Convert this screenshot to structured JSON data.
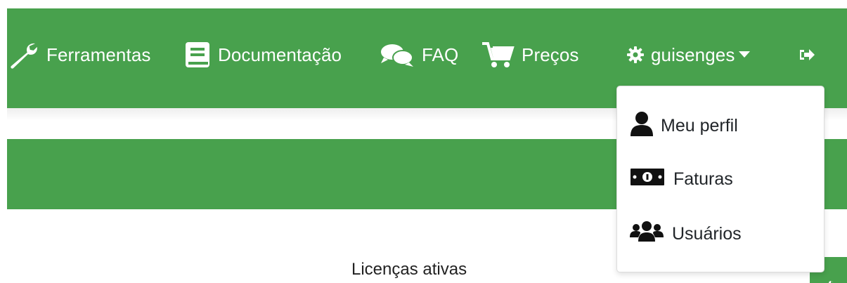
{
  "navbar": {
    "items": [
      {
        "label": "Ferramentas",
        "icon": "wrench-icon"
      },
      {
        "label": "Documentação",
        "icon": "book-icon"
      },
      {
        "label": "FAQ",
        "icon": "comments-icon"
      },
      {
        "label": "Preços",
        "icon": "cart-icon"
      }
    ],
    "user": {
      "label": "guisenges",
      "icon": "gear-icon",
      "caret": "caret-down-icon"
    },
    "logout_icon": "sign-out-icon",
    "color": "#48a14d"
  },
  "dropdown": {
    "items": [
      {
        "label": "Meu perfil",
        "icon": "user-icon"
      },
      {
        "label": "Faturas",
        "icon": "money-bill-icon"
      },
      {
        "label": "Usuários",
        "icon": "users-icon"
      }
    ]
  },
  "main": {
    "section_title": "Licenças ativas"
  }
}
